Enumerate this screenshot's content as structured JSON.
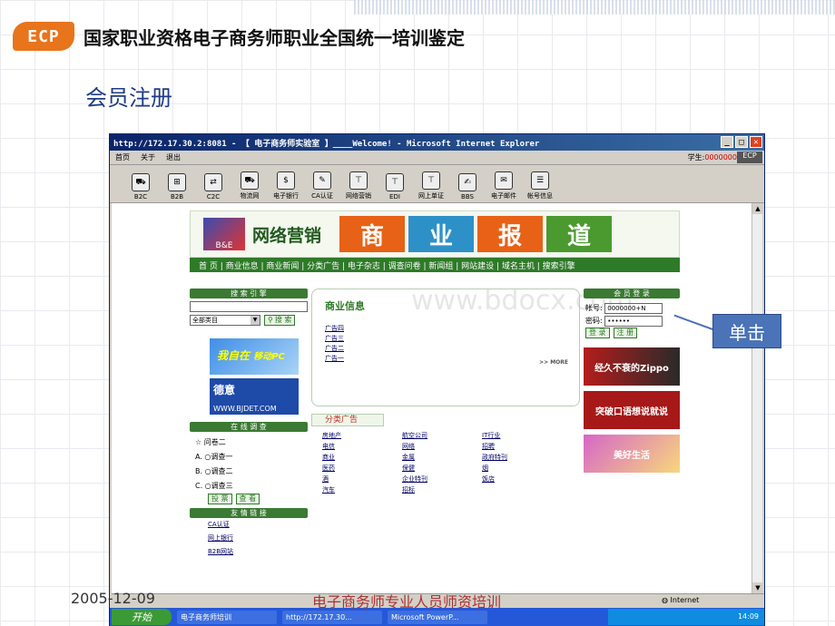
{
  "slide": {
    "title": "国家职业资格电子商务师职业全国统一培训鉴定",
    "logo": "ECP",
    "subtitle": "会员注册",
    "date": "2005-12-09",
    "footer": "电子商务师专业人员师资培训",
    "callout": "单击"
  },
  "browser": {
    "title": "http://172.17.30.2:8081 - 【 电子商务师实验室 】____Welcome! - Microsoft Internet Explorer",
    "menu": [
      "首页",
      "关于",
      "退出"
    ],
    "student_label": "学生:",
    "student_id": "0000000",
    "ecp": "ECP",
    "tools": [
      "B2C",
      "B2B",
      "C2C",
      "物流网",
      "电子银行",
      "CA认证",
      "网络营销",
      "EDI",
      "网上单证",
      "BBS",
      "电子邮件",
      "帐号信息"
    ],
    "status": "Internet"
  },
  "taskbar": {
    "start": "开始",
    "tasks": [
      "电子商务师培训",
      "http://172.17.30...",
      "Microsoft PowerP..."
    ],
    "time": "14:09"
  },
  "web": {
    "banner_logo": "B&E",
    "banner_title": "网络营销",
    "banner_big": [
      "商",
      "业",
      "报",
      "道"
    ],
    "nav": "首  页 | 商业信息 | 商业新闻 | 分类广告 | 电子杂志 | 调查问卷 | 新闻组 | 网站建设 | 域名主机 | 搜索引擎",
    "search_head": "搜 索 引 擎",
    "search_select": "全部类目",
    "search_btn": "搜 索",
    "ad1": "我自在",
    "ad1b": "移动PC",
    "ad2": "德意",
    "ad2_url": "WWW.BJDET.COM",
    "poll_head": "在 线 调 查",
    "poll_q": "问卷二",
    "poll_opts": [
      "调查一",
      "调查二",
      "调查三"
    ],
    "poll_prefix": [
      "A.",
      "B.",
      "C."
    ],
    "vote_btn": "投 票",
    "view_btn": "查 看",
    "friend_head": "友 情 链 接",
    "friends": [
      "CA认证",
      "网上银行",
      "B2B网站"
    ],
    "biz_head": "商业信息",
    "biz_items": [
      "广告四",
      "广告三",
      "广告二",
      "广告一"
    ],
    "more": ">> MORE",
    "class_head": "分类广告",
    "class_items": [
      "房地产",
      "航空公司",
      "IT行业",
      "电信",
      "网络",
      "招聘",
      "商业",
      "金属",
      "政府特刊",
      "医药",
      "保健",
      "烟",
      "酒",
      "企业特刊",
      "饭店",
      "汽车",
      "招标",
      ""
    ],
    "login_head": "会 员 登 录",
    "login_user_label": "帐号:",
    "login_user": "0000000+N",
    "login_pwd_label": "密码:",
    "login_pwd": "••••••",
    "login_btn": "登 录",
    "register_btn": "注 册",
    "ad_r1": "经久不衰的Zippo",
    "ad_r2": "突破口语想说就说",
    "ad_r3": "美好生活",
    "watermark": "www.bdocx.com"
  }
}
